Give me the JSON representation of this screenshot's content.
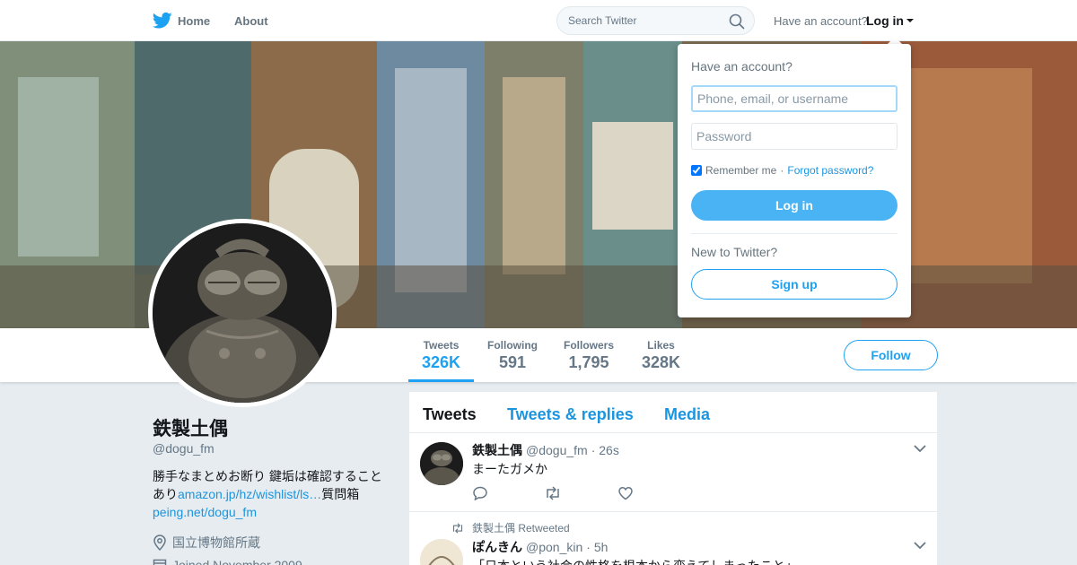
{
  "nav": {
    "home_label": "Home",
    "about_label": "About",
    "search_placeholder": "Search Twitter",
    "have_account": "Have an account?",
    "login_label": "Log in"
  },
  "colors": {
    "accent": "#1da1f2",
    "link": "#1b95e0",
    "muted": "#657786",
    "page_bg": "#e6ecf0"
  },
  "profile_nav": {
    "stats": [
      {
        "label": "Tweets",
        "value": "326K"
      },
      {
        "label": "Following",
        "value": "591"
      },
      {
        "label": "Followers",
        "value": "1,795"
      },
      {
        "label": "Likes",
        "value": "328K"
      }
    ],
    "follow_label": "Follow"
  },
  "profile": {
    "name": "鉄製土偶",
    "handle": "@dogu_fm",
    "bio_text_1": "勝手なまとめお断り 鍵垢は確認すること あり",
    "bio_link_1": "amazon.jp/hz/wishlist/ls…",
    "bio_text_2": "質問箱",
    "bio_link_2": "peing.net/dogu_fm",
    "location": "国立博物館所蔵",
    "joined": "Joined November 2009"
  },
  "timeline": {
    "tabs": [
      "Tweets",
      "Tweets & replies",
      "Media"
    ],
    "tweets": [
      {
        "name": "鉄製土偶",
        "handle": "@dogu_fm",
        "time": "· 26s",
        "text": "まーたガメか"
      },
      {
        "retweet_by": "鉄製土偶 Retweeted",
        "name": "ぽんきん",
        "handle": "@pon_kin",
        "time": "· 5h",
        "text": "「日本という社会の性格を根本から変えてしまったこと」"
      }
    ]
  },
  "login_dropdown": {
    "title": "Have an account?",
    "username_placeholder": "Phone, email, or username",
    "password_placeholder": "Password",
    "remember_label": "Remember me",
    "separator": "·",
    "forgot_label": "Forgot password?",
    "login_button": "Log in",
    "new_label": "New to Twitter?",
    "signup_button": "Sign up"
  }
}
